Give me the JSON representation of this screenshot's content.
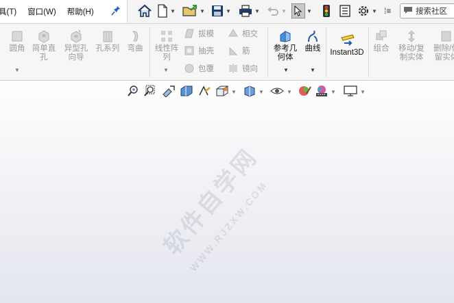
{
  "menubar": {
    "items": [
      "具(T)",
      "窗口(W)",
      "帮助(H)"
    ]
  },
  "toolbar": {
    "search_placeholder": "搜索社区"
  },
  "ribbon": {
    "groups": {
      "fillet": "圆角",
      "simple_hole": "简单直孔",
      "hole_wizard": "异型孔向导",
      "hole_series": "孔系列",
      "wrap": "弯曲",
      "linear_pattern": "线性阵列",
      "draft": "拔模",
      "intersect": "相交",
      "shell": "抽壳",
      "rib": "筋",
      "wrap2": "包覆",
      "mirror": "镜向",
      "reference_geometry": "参考几何体",
      "curves": "曲线",
      "instant3d": "Instant3D",
      "combine": "组合",
      "move_copy": "移动/复制实体",
      "delete_keep": "删除/保留实体"
    }
  },
  "watermark": {
    "main": "软件自学网",
    "sub": "WWW.RJZXW.COM"
  }
}
